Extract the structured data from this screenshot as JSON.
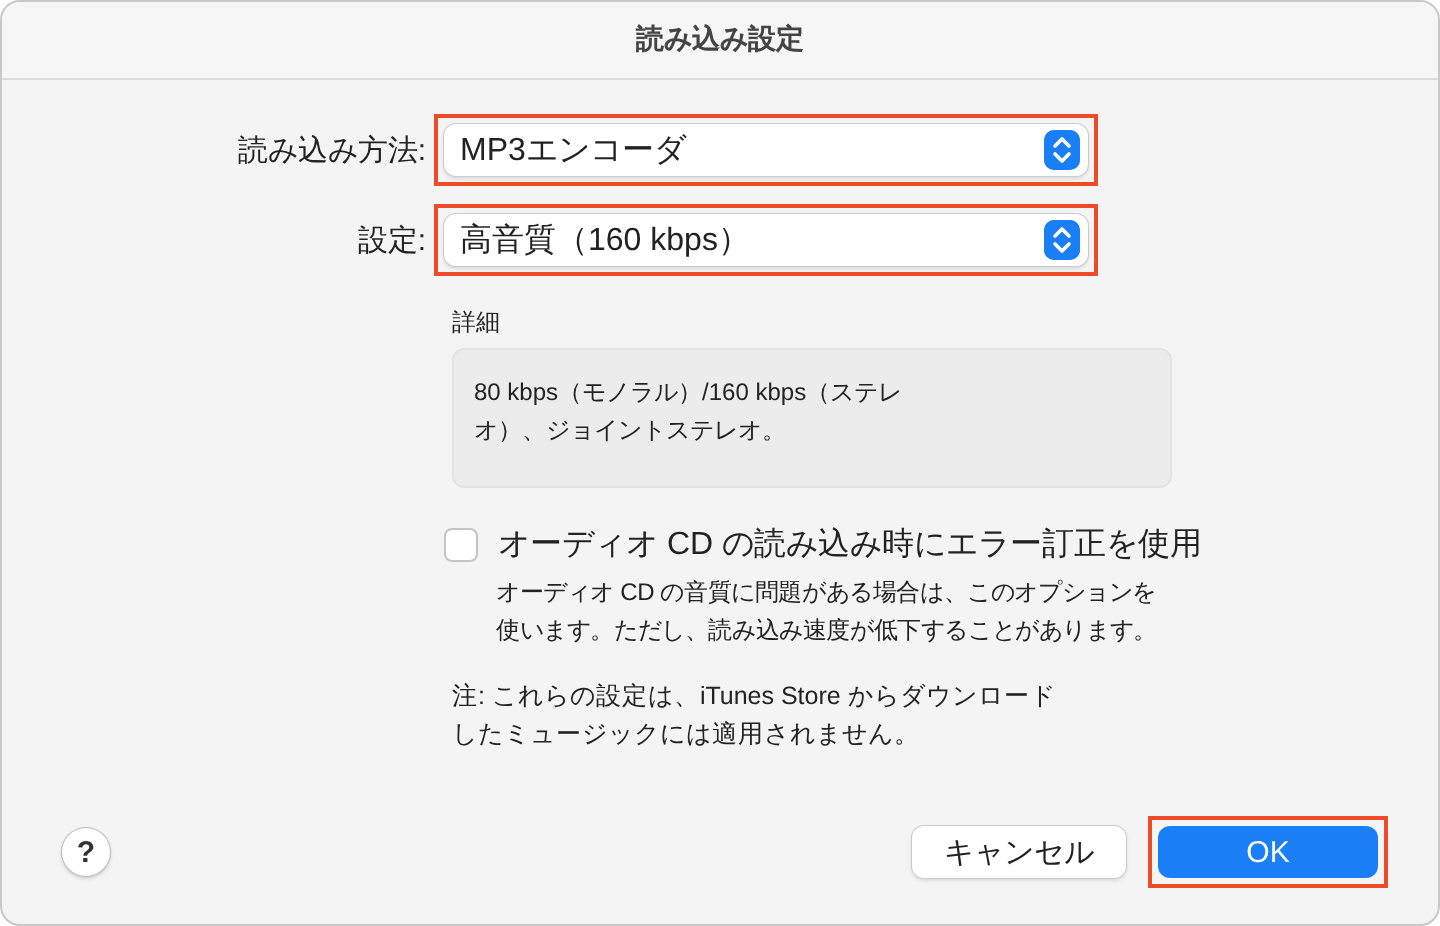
{
  "window": {
    "title": "読み込み設定"
  },
  "fields": [
    {
      "label": "読み込み方法:",
      "value": "MP3エンコーダ",
      "highlighted": true
    },
    {
      "label": "設定:",
      "value": "高音質（160 kbps）",
      "highlighted": true
    }
  ],
  "details": {
    "label": "詳細",
    "text": "80 kbps（モノラル）/160 kbps（ステレオ）、ジョイントステレオ。"
  },
  "error_correction": {
    "label": "オーディオ CD の読み込み時にエラー訂正を使用",
    "checked": false,
    "description": "オーディオ CD の音質に問題がある場合は、このオプションを使います。ただし、読み込み速度が低下することがあります。"
  },
  "note": "注: これらの設定は、iTunes Store からダウンロードしたミュージックには適用されません。",
  "help_button": {
    "label": "?"
  },
  "buttons": [
    {
      "label": "キャンセル",
      "kind": "secondary",
      "highlighted": false
    },
    {
      "label": "OK",
      "kind": "primary",
      "highlighted": true
    }
  ]
}
